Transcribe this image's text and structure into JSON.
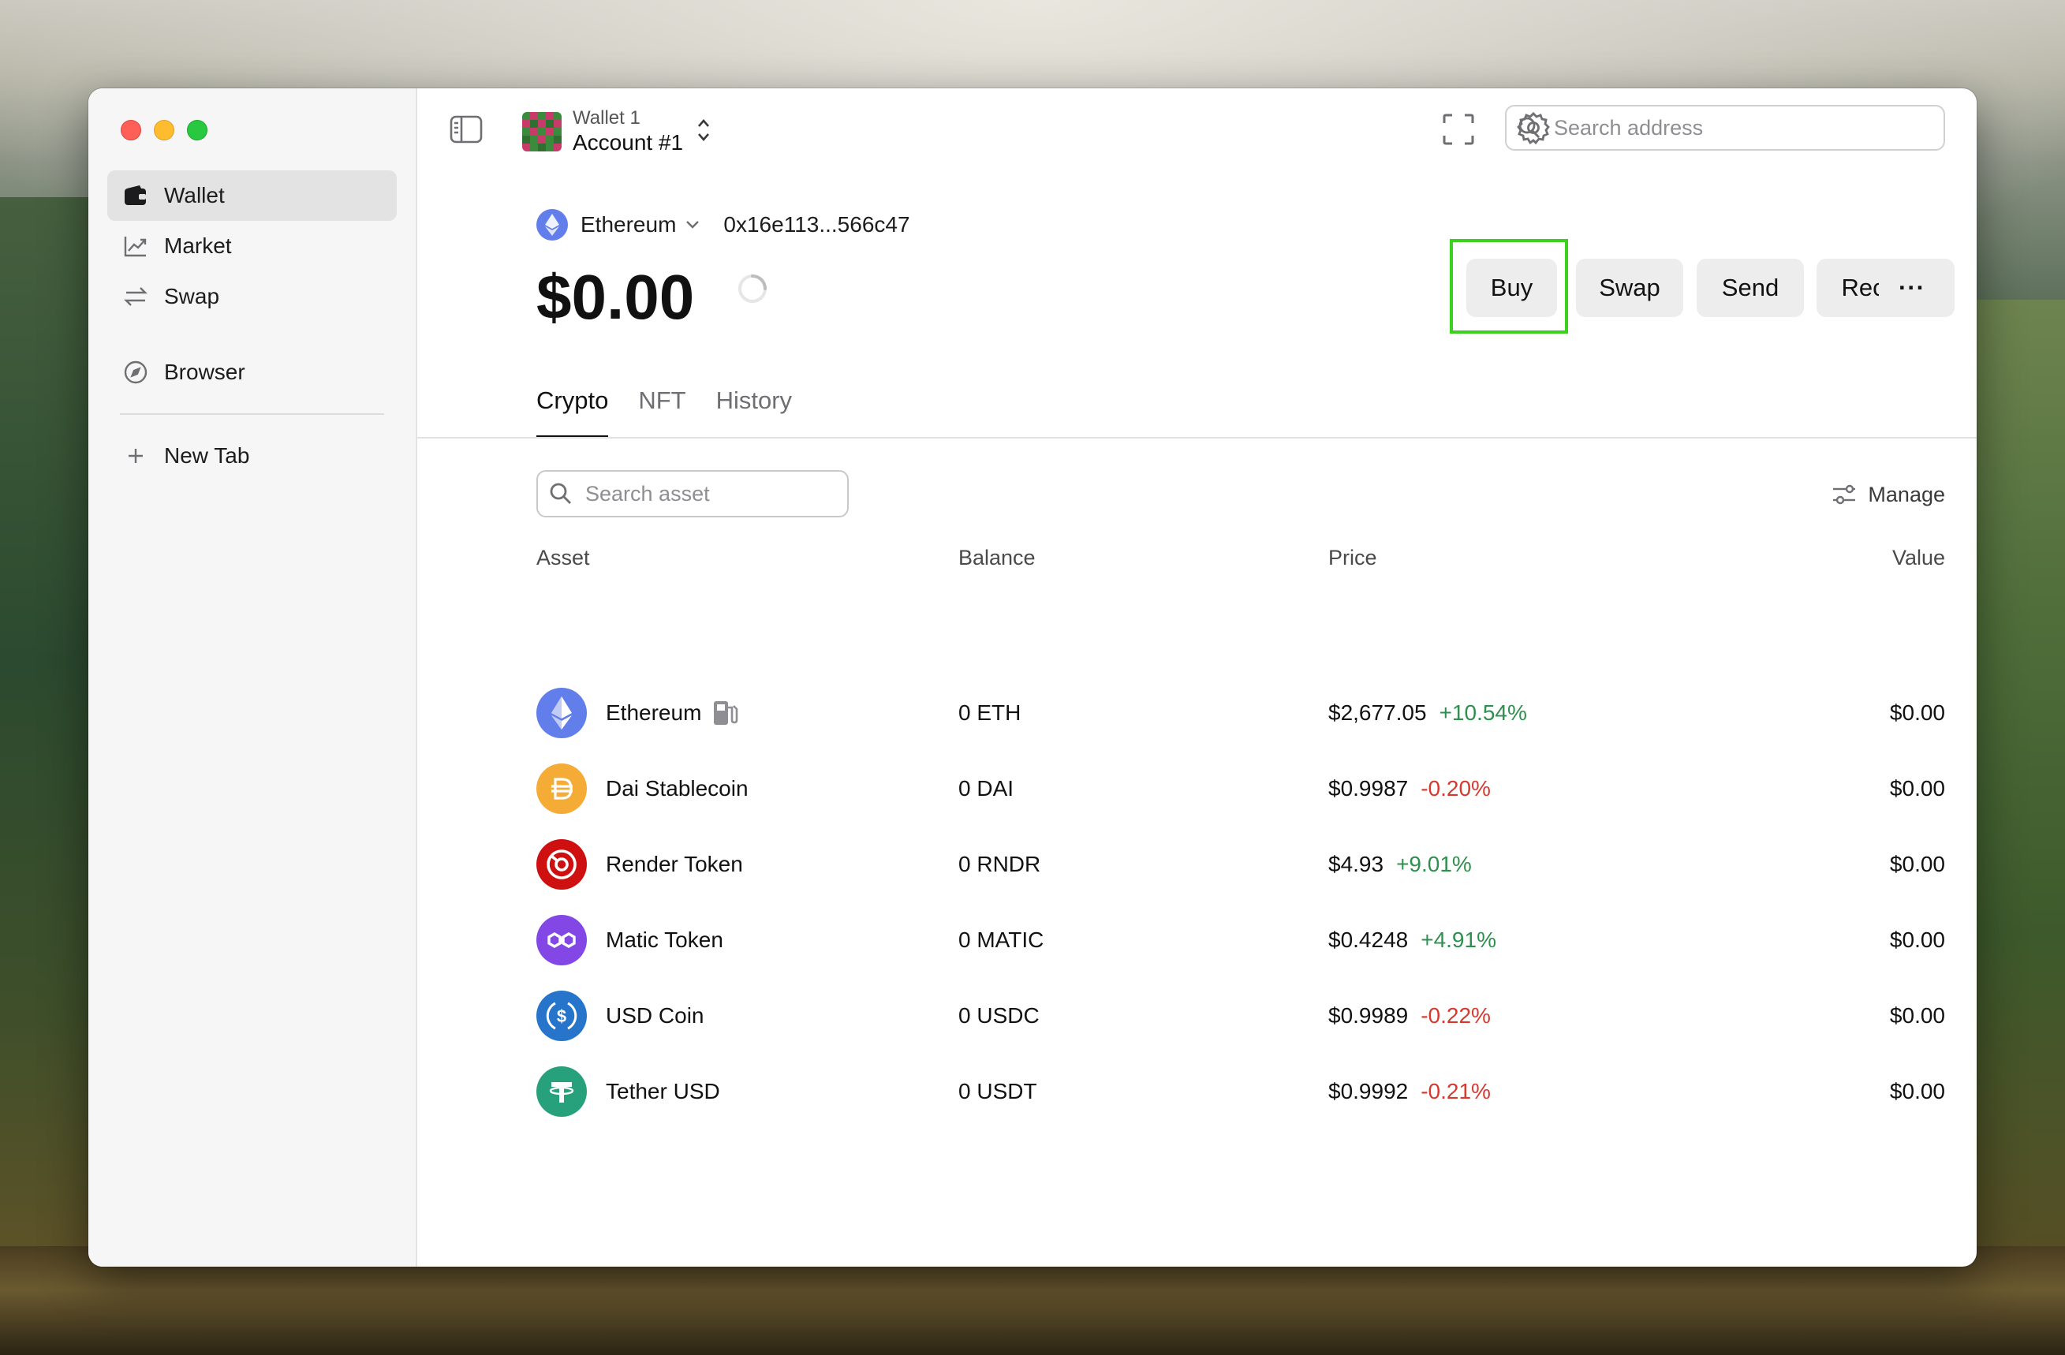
{
  "sidebar": {
    "items": [
      {
        "label": "Wallet",
        "icon": "wallet-icon",
        "active": true
      },
      {
        "label": "Market",
        "icon": "chart-icon"
      },
      {
        "label": "Swap",
        "icon": "swap-arrows-icon"
      },
      {
        "label": "Browser",
        "icon": "compass-icon"
      },
      {
        "label": "New Tab",
        "icon": "plus-icon"
      }
    ]
  },
  "header": {
    "wallet_name": "Wallet 1",
    "account_name": "Account #1",
    "search_placeholder": "Search address"
  },
  "network": {
    "name": "Ethereum",
    "address": "0x16e113...566c47"
  },
  "balance": "$0.00",
  "actions": {
    "buy": "Buy",
    "swap": "Swap",
    "send": "Send",
    "receive": "Receive",
    "more": "···"
  },
  "tabs": [
    "Crypto",
    "NFT",
    "History"
  ],
  "asset_search_placeholder": "Search asset",
  "manage_label": "Manage",
  "table": {
    "headers": {
      "asset": "Asset",
      "balance": "Balance",
      "price": "Price",
      "value": "Value"
    },
    "rows": [
      {
        "name": "Ethereum",
        "balance": "0 ETH",
        "price": "$2,677.05",
        "change": "+10.54%",
        "direction": "up",
        "value": "$0.00",
        "icon": "ethereum-icon",
        "color": "#627eea"
      },
      {
        "name": "Dai Stablecoin",
        "balance": "0 DAI",
        "price": "$0.9987",
        "change": "-0.20%",
        "direction": "down",
        "value": "$0.00",
        "icon": "dai-icon",
        "color": "#f5ac37"
      },
      {
        "name": "Render Token",
        "balance": "0 RNDR",
        "price": "$4.93",
        "change": "+9.01%",
        "direction": "up",
        "value": "$0.00",
        "icon": "render-icon",
        "color": "#cf1011"
      },
      {
        "name": "Matic Token",
        "balance": "0 MATIC",
        "price": "$0.4248",
        "change": "+4.91%",
        "direction": "up",
        "value": "$0.00",
        "icon": "polygon-icon",
        "color": "#8247e5"
      },
      {
        "name": "USD Coin",
        "balance": "0 USDC",
        "price": "$0.9989",
        "change": "-0.22%",
        "direction": "down",
        "value": "$0.00",
        "icon": "usdc-icon",
        "color": "#2775ca"
      },
      {
        "name": "Tether USD",
        "balance": "0 USDT",
        "price": "$0.9992",
        "change": "-0.21%",
        "direction": "down",
        "value": "$0.00",
        "icon": "tether-icon",
        "color": "#26a17b"
      }
    ]
  },
  "colors": {
    "positive": "#2f8f4e",
    "negative": "#d63a2f",
    "highlight": "#3bd11d"
  }
}
